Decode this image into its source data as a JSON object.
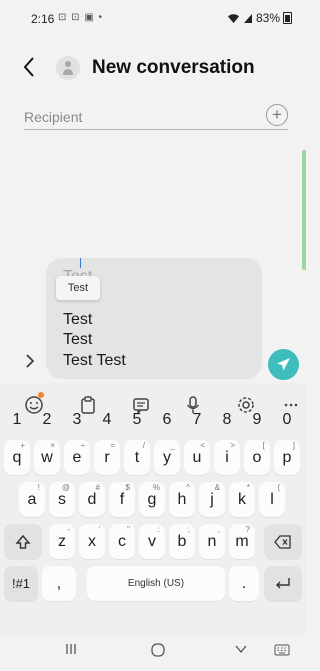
{
  "status_bar": {
    "time": "2:16",
    "notifications": "⊡ ⊡ ▣ •",
    "battery": "83%"
  },
  "header": {
    "title": "New conversation"
  },
  "recipient": {
    "placeholder": "Recipient",
    "value": ""
  },
  "compose": {
    "ghost_lines": [
      "Test",
      "Test"
    ],
    "drag_chip": "Test",
    "lines": [
      "Test",
      "Test",
      "Test Test"
    ]
  },
  "keyboard": {
    "toolbar_icons": [
      "emoji-icon",
      "clipboard-icon",
      "sticker-icon",
      "microphone-icon",
      "settings-icon",
      "more-icon"
    ],
    "number_row": [
      "1",
      "2",
      "3",
      "4",
      "5",
      "6",
      "7",
      "8",
      "9",
      "0"
    ],
    "row1": [
      {
        "key": "q",
        "hint": "+"
      },
      {
        "key": "w",
        "hint": "×"
      },
      {
        "key": "e",
        "hint": "÷"
      },
      {
        "key": "r",
        "hint": "="
      },
      {
        "key": "t",
        "hint": "/"
      },
      {
        "key": "y",
        "hint": "_"
      },
      {
        "key": "u",
        "hint": "<"
      },
      {
        "key": "i",
        "hint": ">"
      },
      {
        "key": "o",
        "hint": "["
      },
      {
        "key": "p",
        "hint": "]"
      }
    ],
    "row2": [
      {
        "key": "a",
        "hint": "!"
      },
      {
        "key": "s",
        "hint": "@"
      },
      {
        "key": "d",
        "hint": "#"
      },
      {
        "key": "f",
        "hint": "$"
      },
      {
        "key": "g",
        "hint": "%"
      },
      {
        "key": "h",
        "hint": "^"
      },
      {
        "key": "j",
        "hint": "&"
      },
      {
        "key": "k",
        "hint": "*"
      },
      {
        "key": "l",
        "hint": "("
      }
    ],
    "row3": [
      {
        "key": "z",
        "hint": "-"
      },
      {
        "key": "x",
        "hint": "'"
      },
      {
        "key": "c",
        "hint": "\""
      },
      {
        "key": "v",
        "hint": ":"
      },
      {
        "key": "b",
        "hint": ";"
      },
      {
        "key": "n",
        "hint": ","
      },
      {
        "key": "m",
        "hint": "?"
      }
    ],
    "symbols_label": "!#1",
    "comma_label": ",",
    "space_label": "English (US)",
    "period_label": "."
  },
  "colors": {
    "accent": "#3dbdbb",
    "badge": "#f2862b",
    "edge_handle": "#99d99c"
  }
}
